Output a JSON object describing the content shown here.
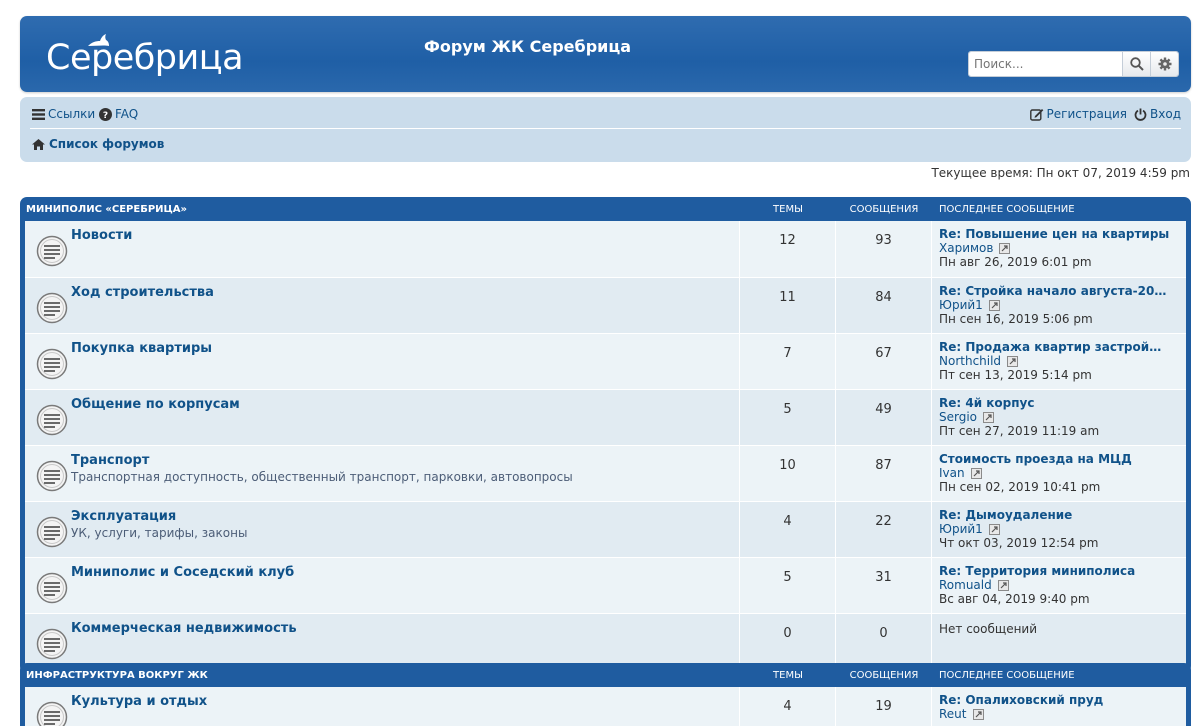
{
  "header": {
    "logo_text": "Серебрица",
    "site_title": "Форум ЖК Серебрица",
    "search_placeholder": "Поиск...",
    "search_icon": "search-icon",
    "advanced_search_icon": "gear-icon"
  },
  "navbar": {
    "links_label": "Ссылки",
    "faq_label": "FAQ",
    "register_label": "Регистрация",
    "login_label": "Вход",
    "breadcrumb_label": "Список форумов"
  },
  "current_time": "Текущее время: Пн окт 07, 2019 4:59 pm",
  "columns": {
    "topics": "ТЕМЫ",
    "posts": "СООБЩЕНИЯ",
    "last_post": "ПОСЛЕДНЕЕ СООБЩЕНИЕ"
  },
  "categories": [
    {
      "name": "МИНИПОЛИС «СЕРЕБРИЦА»",
      "forums": [
        {
          "title": "Новости",
          "desc": "",
          "topics": "12",
          "posts": "93",
          "last_title": "Re: Повышение цен на квартиры",
          "last_author": "Харимов",
          "last_date": "Пн авг 26, 2019 6:01 pm"
        },
        {
          "title": "Ход строительства",
          "desc": "",
          "topics": "11",
          "posts": "84",
          "last_title": "Re: Стройка начало августа-20…",
          "last_author": "Юрий1",
          "last_date": "Пн сен 16, 2019 5:06 pm"
        },
        {
          "title": "Покупка квартиры",
          "desc": "",
          "topics": "7",
          "posts": "67",
          "last_title": "Re: Продажа квартир застройщи…",
          "last_author": "Northchild",
          "last_date": "Пт сен 13, 2019 5:14 pm"
        },
        {
          "title": "Общение по корпусам",
          "desc": "",
          "topics": "5",
          "posts": "49",
          "last_title": "Re: 4й корпус",
          "last_author": "Sergio",
          "last_date": "Пт сен 27, 2019 11:19 am"
        },
        {
          "title": "Транспорт",
          "desc": "Транспортная доступность, общественный транспорт, парковки, автовопросы",
          "topics": "10",
          "posts": "87",
          "last_title": "Стоимость проезда на МЦД",
          "last_author": "Ivan",
          "last_date": "Пн сен 02, 2019 10:41 pm"
        },
        {
          "title": "Эксплуатация",
          "desc": "УК, услуги, тарифы, законы",
          "topics": "4",
          "posts": "22",
          "last_title": "Re: Дымоудаление",
          "last_author": "Юрий1",
          "last_date": "Чт окт 03, 2019 12:54 pm"
        },
        {
          "title": "Миниполис и Соседский клуб",
          "desc": "",
          "topics": "5",
          "posts": "31",
          "last_title": "Re: Территория миниполиса",
          "last_author": "Romuald",
          "last_date": "Вс авг 04, 2019 9:40 pm"
        },
        {
          "title": "Коммерческая недвижимость",
          "desc": "",
          "topics": "0",
          "posts": "0",
          "last_none": "Нет сообщений"
        }
      ]
    },
    {
      "name": "ИНФРАСТРУКТУРА ВОКРУГ ЖК",
      "forums": [
        {
          "title": "Культура и отдых",
          "desc": "",
          "topics": "4",
          "posts": "19",
          "last_title": "Re: Опалиховский пруд",
          "last_author": "Reut",
          "last_date": ""
        }
      ]
    }
  ]
}
